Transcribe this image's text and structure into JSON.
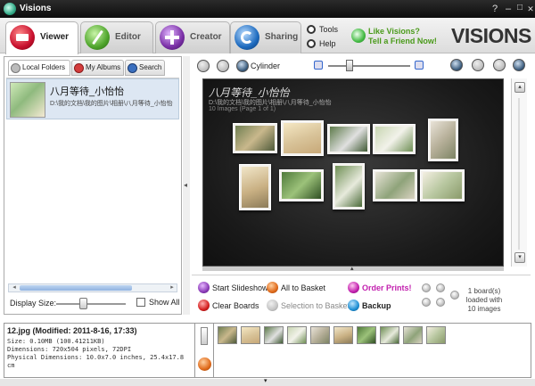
{
  "titlebar": {
    "title": "Visions",
    "help_glyph": "?",
    "minimize_glyph": "–",
    "maximize_glyph": "□",
    "close_glyph": "✕"
  },
  "tabs": [
    {
      "label": "Viewer",
      "color": "#c8102e",
      "active": true
    },
    {
      "label": "Editor",
      "color": "#4fa52c",
      "active": false
    },
    {
      "label": "Creator",
      "color": "#7a2fa6",
      "active": false
    },
    {
      "label": "Sharing",
      "color": "#1e6bbf",
      "active": false
    }
  ],
  "header": {
    "tools_label": "Tools",
    "help_label": "Help",
    "promo_line1": "Like Visions?",
    "promo_line2": "Tell a Friend Now!",
    "brand": "VISIONS"
  },
  "left_panel": {
    "tabs": [
      {
        "label": "Local Folders",
        "active": true
      },
      {
        "label": "My Albums",
        "active": false
      },
      {
        "label": "Search",
        "active": false
      }
    ],
    "folders": [
      {
        "name": "八月等待_小怡怡",
        "path": "D:\\我的文档\\我的图片\\相册\\八月等待_小怡怡"
      }
    ],
    "display_size_label": "Display Size:",
    "display_size_level": 0.35,
    "show_all_label": "Show All"
  },
  "toolbar": {
    "mode_label": "Cylinder"
  },
  "viewer": {
    "album_title": "八月等待_小怡怡",
    "album_path": "D:\\我的文档\\我的图片\\相册\\八月等待_小怡怡",
    "album_info": "10 Images (Page 1 of 1)"
  },
  "actions": {
    "start_slideshow": "Start Slideshow",
    "all_to_basket": "All to Basket",
    "order_prints": "Order Prints!",
    "clear_boards": "Clear Boards",
    "selection_to_basket": "Selection to Basket",
    "backup": "Backup",
    "boards_status": "1 board(s) loaded with 10 images"
  },
  "info": {
    "heading": "12.jpg (Modified: 2011-8-16, 17:33)",
    "size": "Size: 0.10MB (100.41211KB)",
    "dimensions": "Dimensions: 720x504 pixels, 72DPI",
    "physical": "Physical Dimensions: 10.0x7.0 inches, 25.4x17.8",
    "physical_unit": "cm"
  }
}
